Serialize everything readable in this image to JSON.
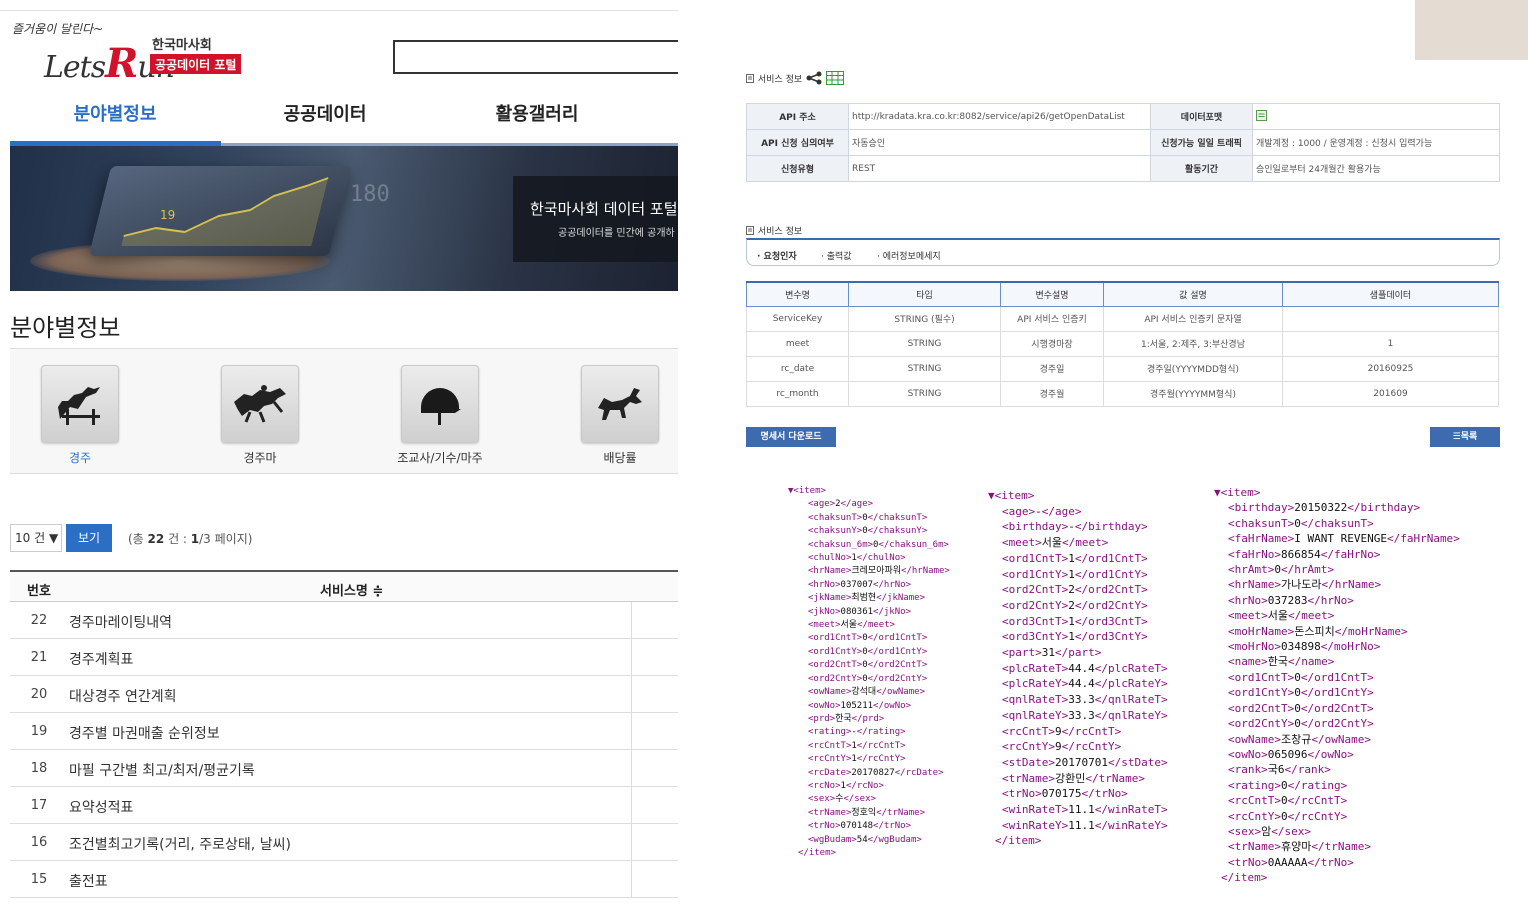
{
  "left": {
    "slogan": "즐거움이 달린다~",
    "logo_lets": "Lets",
    "logo_r": "R",
    "logo_un": "un",
    "logo_org": "한국마사회",
    "logo_portal": "공공데이터 포털",
    "nav": [
      "분야별정보",
      "공공데이터",
      "활용갤러리"
    ],
    "banner_title": "한국마사회 데이터 포털",
    "banner_sub": "공공데이터를 민간에 공개하",
    "banner_num1": "180",
    "banner_num2": "19",
    "section_title": "분야별정보",
    "categories": [
      "경주",
      "경주마",
      "조교사/기수/마주",
      "배당률"
    ],
    "page_size": "10 건 ▼",
    "view_button": "보기",
    "pager_prefix": "(총 ",
    "pager_total": "22",
    "pager_mid": " 건 : ",
    "pager_page": "1",
    "pager_suffix": "/3 페이지)",
    "table_head_no": "번호",
    "table_head_name": "서비스명 ≑",
    "rows": [
      {
        "no": "22",
        "name": "경주마레이팅내역"
      },
      {
        "no": "21",
        "name": "경주계획표"
      },
      {
        "no": "20",
        "name": "대상경주 연간계획"
      },
      {
        "no": "19",
        "name": "경주별 마권매출 순위정보"
      },
      {
        "no": "18",
        "name": "마필 구간별 최고/최저/평균기록"
      },
      {
        "no": "17",
        "name": "요약성적표"
      },
      {
        "no": "16",
        "name": "조건별최고기록(거리, 주로상태, 날씨)"
      },
      {
        "no": "15",
        "name": "출전표"
      }
    ]
  },
  "right": {
    "service_info_title": "서비스 정보",
    "api_info": {
      "api_addr_label": "API 주소",
      "api_addr": "http://kradata.kra.co.kr:8082/service/api26/getOpenDataList",
      "format_label": "데이터포맷",
      "approval_label": "API 신청 심의여부",
      "approval": "자동승인",
      "traffic_label": "신청가능 일일 트래픽",
      "traffic": "개발계정 : 1000 / 운영계정 : 신청시 입력가능",
      "type_label": "신청유형",
      "type": "REST",
      "period_label": "활동기간",
      "period": "승인일로부터 24개월간 활용가능"
    },
    "service_info_title2": "서비스 정보",
    "tabs": [
      "· 요청인자",
      "· 출력값",
      "· 에러정보메세지"
    ],
    "var_table": {
      "headers": [
        "변수명",
        "타입",
        "변수설명",
        "값 설명",
        "샘플데이터"
      ],
      "rows": [
        [
          "ServiceKey",
          "STRING (필수)",
          "API 서비스 인증키",
          "API 서비스 인증키 문자열",
          ""
        ],
        [
          "meet",
          "STRING",
          "시행경마장",
          "1:서울, 2:제주, 3:부산경남",
          "1"
        ],
        [
          "rc_date",
          "STRING",
          "경주일",
          "경주일(YYYYMDD형식)",
          "20160925"
        ],
        [
          "rc_month",
          "STRING",
          "경주월",
          "경주월(YYYYMM형식)",
          "201609"
        ]
      ]
    },
    "spec_button": "명세서 다운로드",
    "list_button": "☰목록",
    "xml1": [
      [
        "age",
        "2"
      ],
      [
        "chaksunT",
        "0"
      ],
      [
        "chaksunY",
        "0"
      ],
      [
        "chaksun_6m",
        "0"
      ],
      [
        "chulNo",
        "1"
      ],
      [
        "hrName",
        "크레모아파워"
      ],
      [
        "hrNo",
        "037007"
      ],
      [
        "jkName",
        "최범현"
      ],
      [
        "jkNo",
        "080361"
      ],
      [
        "meet",
        "서울"
      ],
      [
        "ord1CntT",
        "0"
      ],
      [
        "ord1CntY",
        "0"
      ],
      [
        "ord2CntT",
        "0"
      ],
      [
        "ord2CntY",
        "0"
      ],
      [
        "owName",
        "강석대"
      ],
      [
        "owNo",
        "105211"
      ],
      [
        "prd",
        "한국"
      ],
      [
        "rating",
        "-"
      ],
      [
        "rcCntT",
        "1"
      ],
      [
        "rcCntY",
        "1"
      ],
      [
        "rcDate",
        "20170827"
      ],
      [
        "rcNo",
        "1"
      ],
      [
        "sex",
        "수"
      ],
      [
        "trName",
        "정호익"
      ],
      [
        "trNo",
        "070148"
      ],
      [
        "wgBudam",
        "54"
      ]
    ],
    "xml2": [
      [
        "age",
        "-"
      ],
      [
        "birthday",
        "-"
      ],
      [
        "meet",
        "서울"
      ],
      [
        "ord1CntT",
        "1"
      ],
      [
        "ord1CntY",
        "1"
      ],
      [
        "ord2CntT",
        "2"
      ],
      [
        "ord2CntY",
        "2"
      ],
      [
        "ord3CntT",
        "1"
      ],
      [
        "ord3CntY",
        "1"
      ],
      [
        "part",
        "31"
      ],
      [
        "plcRateT",
        "44.4"
      ],
      [
        "plcRateY",
        "44.4"
      ],
      [
        "qnlRateT",
        "33.3"
      ],
      [
        "qnlRateY",
        "33.3"
      ],
      [
        "rcCntT",
        "9"
      ],
      [
        "rcCntY",
        "9"
      ],
      [
        "stDate",
        "20170701"
      ],
      [
        "trName",
        "강환민"
      ],
      [
        "trNo",
        "070175"
      ],
      [
        "winRateT",
        "11.1"
      ],
      [
        "winRateY",
        "11.1"
      ]
    ],
    "xml3": [
      [
        "birthday",
        "20150322"
      ],
      [
        "chaksunT",
        "0"
      ],
      [
        "faHrName",
        "I WANT REVENGE"
      ],
      [
        "faHrNo",
        "866854"
      ],
      [
        "hrAmt",
        "0"
      ],
      [
        "hrName",
        "가나도라"
      ],
      [
        "hrNo",
        "037283"
      ],
      [
        "meet",
        "서울"
      ],
      [
        "moHrName",
        "돈스피치"
      ],
      [
        "moHrNo",
        "034898"
      ],
      [
        "name",
        "한국"
      ],
      [
        "ord1CntT",
        "0"
      ],
      [
        "ord1CntY",
        "0"
      ],
      [
        "ord2CntT",
        "0"
      ],
      [
        "ord2CntY",
        "0"
      ],
      [
        "owName",
        "조창규"
      ],
      [
        "owNo",
        "065096"
      ],
      [
        "rank",
        "국6"
      ],
      [
        "rating",
        "0"
      ],
      [
        "rcCntT",
        "0"
      ],
      [
        "rcCntY",
        "0"
      ],
      [
        "sex",
        "암"
      ],
      [
        "trName",
        "휴양마"
      ],
      [
        "trNo",
        "0AAAAA"
      ]
    ],
    "xml_open": "▼<item>",
    "xml_close": "</item>"
  },
  "colors": {
    "accent_blue": "#2b6fc5",
    "brand_red": "#d1122b",
    "xml_tag": "#881280",
    "table_header_blue": "#3d6bb0"
  }
}
